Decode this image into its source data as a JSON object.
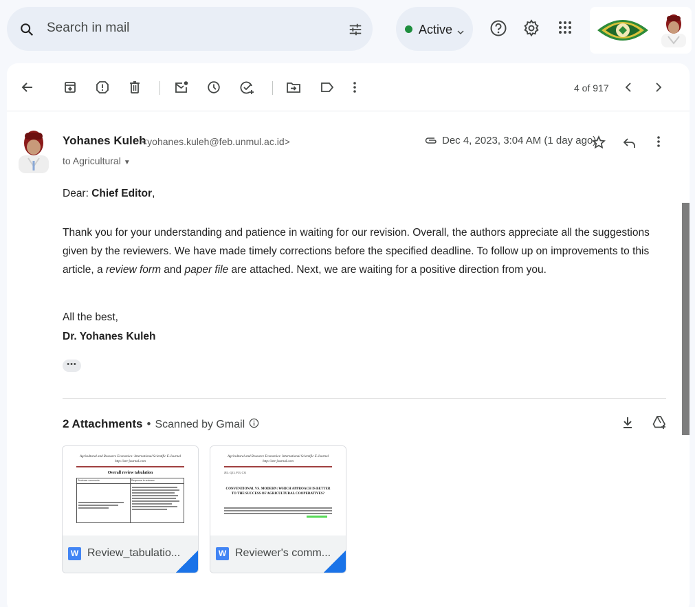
{
  "search": {
    "placeholder": "Search in mail",
    "icon": "search-icon",
    "filter_icon": "tune-icon"
  },
  "status": {
    "label": "Active",
    "color": "#1e8e3e"
  },
  "header_icons": [
    "help-icon",
    "settings-gear-icon",
    "apps-grid-icon"
  ],
  "toolbar": {
    "buttons": [
      "back-arrow-icon",
      "archive-icon",
      "report-spam-icon",
      "delete-icon",
      "mark-unread-icon",
      "snooze-icon",
      "add-to-tasks-icon",
      "move-to-icon",
      "labels-icon",
      "more-vert-icon"
    ],
    "pager": "4 of 917"
  },
  "message": {
    "sender_name": "Yohanes Kuleh",
    "sender_email": "<yohanes.kuleh@feb.unmul.ac.id>",
    "to": "to Agricultural",
    "date": "Dec 4, 2023, 3:04 AM (1 day ago)",
    "greeting_prefix": "Dear: ",
    "greeting_name": "Chief Editor",
    "greeting_suffix": ",",
    "body_1": "Thank you for your understanding and patience in waiting for our revision. Overall, the authors appreciate all the suggestions given by the reviewers. We have made timely corrections before the specified deadline. To follow up on improvements to this article, a ",
    "body_em1": "review form",
    "body_2": " and ",
    "body_em2": "paper file",
    "body_3": " are attached. Next, we are waiting for a positive direction from you.",
    "closing": "All the best,",
    "signature": "Dr. Yohanes Kuleh",
    "trimmed": "•••"
  },
  "attachments": {
    "count_label": "2 Attachments",
    "bullet": "•",
    "scanned": "Scanned by Gmail",
    "files": [
      {
        "name": "Review_tabulatio...",
        "preview_header": "Agricultural and Resource Economics: International Scientific E-Journal",
        "preview_link": "http://are-journal.com",
        "preview_title": "Overall review tabulation",
        "col_1": "Reviewer comments",
        "col_2": "Response to reviewer"
      },
      {
        "name": "Reviewer's comm...",
        "preview_header": "Agricultural and Resource Economics: International Scientific E-Journal",
        "preview_link": "http://are-journal.com",
        "preview_jel": "JEL: Q13, P13, C31",
        "preview_title": "CONVENTIONAL VS. MODERN: WHICH APPROACH IS BETTER TO THE SUCCESS OF AGRICULTURAL COOPERATIVES?"
      }
    ]
  }
}
